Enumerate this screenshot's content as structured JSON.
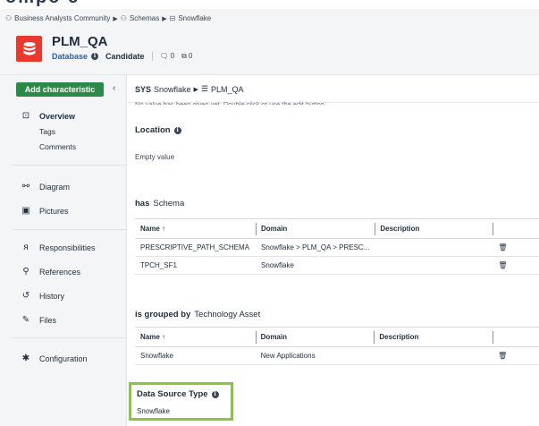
{
  "top_strip_text": "ompo e",
  "breadcrumb": {
    "items": [
      "Business Analysts Community",
      "Schemas",
      "Snowflake"
    ]
  },
  "asset": {
    "title": "PLM_QA",
    "type": "Database",
    "status": "Candidate",
    "comments_count": "0",
    "relations_count": "0"
  },
  "sidebar": {
    "add_button": "Add characteristic",
    "collapse": "‹",
    "items": {
      "overview": "Overview",
      "tags": "Tags",
      "comments": "Comments",
      "diagram": "Diagram",
      "pictures": "Pictures",
      "responsibilities": "Responsibilities",
      "references": "References",
      "history": "History",
      "files": "Files",
      "configuration": "Configuration"
    }
  },
  "main": {
    "breadcrumb": {
      "prefix": "SYS",
      "parent": "Snowflake",
      "current": "PLM_QA"
    },
    "cut_text": "No value has been given yet. Double click or use the edit button.",
    "location": {
      "title": "Location",
      "value": "Empty value"
    },
    "has_schema": {
      "title_bold": "has",
      "title_plain": "Schema",
      "columns": [
        "Name",
        "Domain",
        "Description"
      ],
      "rows": [
        {
          "name": "PRESCRIPTIVE_PATH_SCHEMA",
          "domain": "Snowflake > PLM_QA > PRESC...",
          "description": ""
        },
        {
          "name": "TPCH_SF1",
          "domain": "Snowflake",
          "description": ""
        }
      ]
    },
    "grouped_by": {
      "title_bold": "is grouped by",
      "title_plain": "Technology Asset",
      "columns": [
        "Name",
        "Domain",
        "Description"
      ],
      "rows": [
        {
          "name": "Snowflake",
          "domain": "New Applications",
          "description": ""
        }
      ]
    },
    "data_source_type": {
      "title": "Data Source Type",
      "value": "Snowflake"
    }
  },
  "colors": {
    "accent_red": "#e8392e",
    "primary_green": "#2b8a4a",
    "link_blue": "#1a64b8",
    "highlight_green": "#8bc53f"
  }
}
